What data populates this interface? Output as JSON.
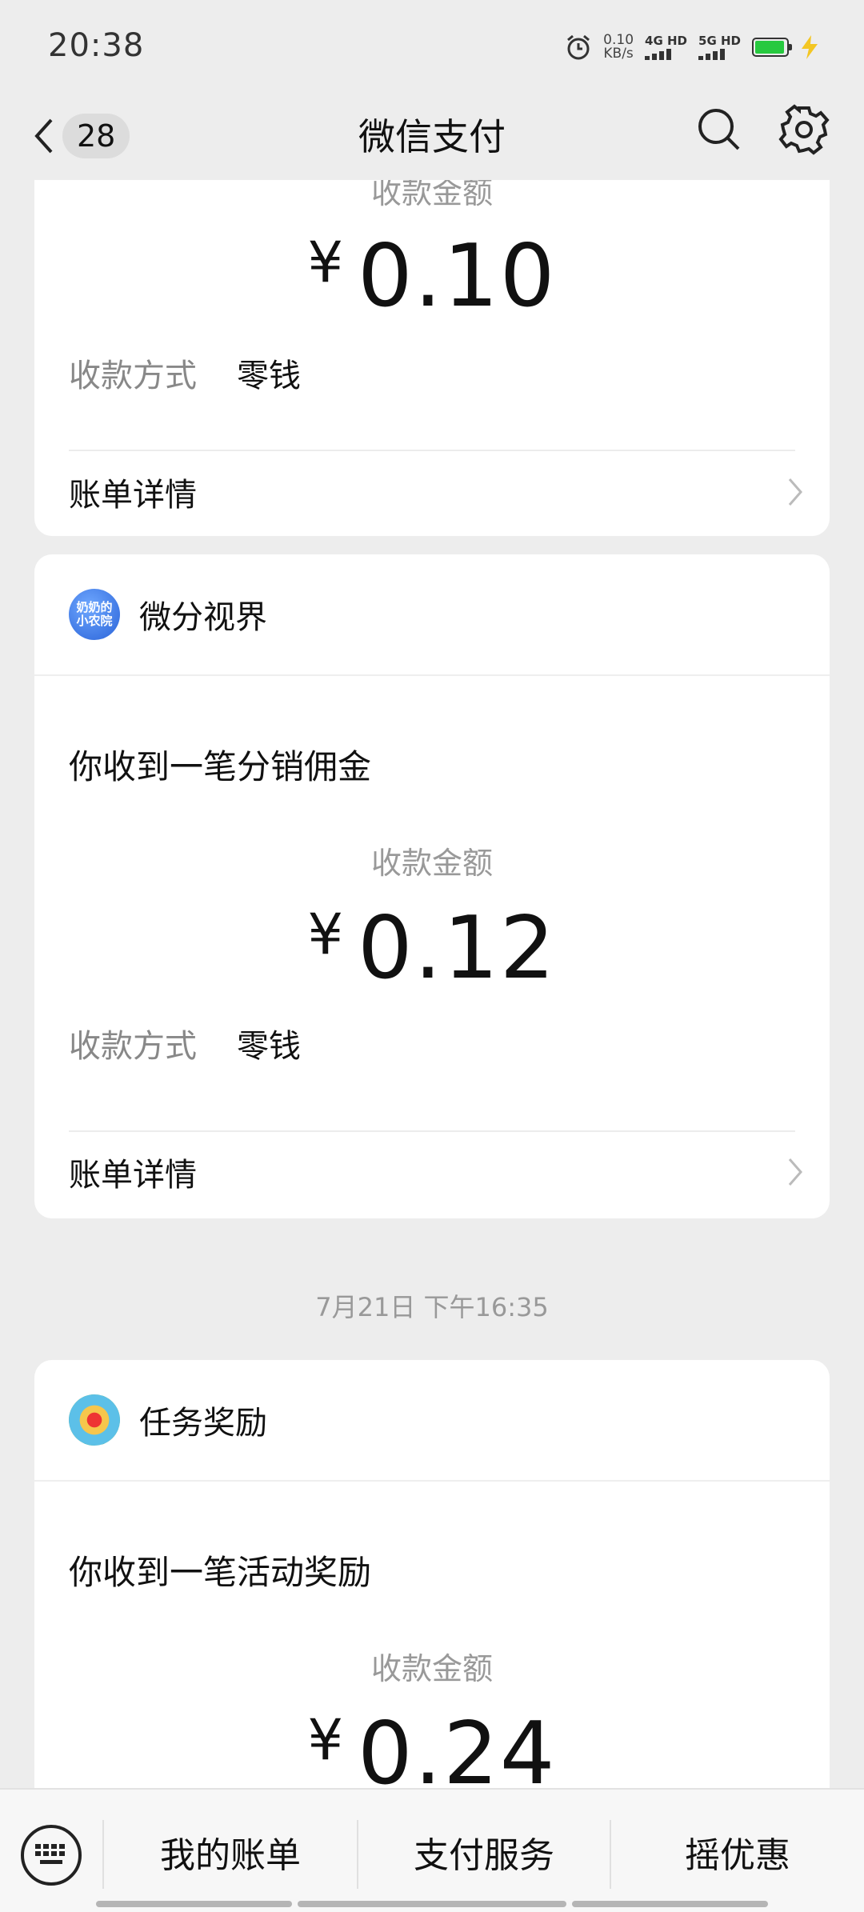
{
  "status_bar": {
    "time": "20:38",
    "net_speed_value": "0.10",
    "net_speed_unit": "KB/s",
    "sim1": "4G HD",
    "sim2": "5G HD"
  },
  "header": {
    "back_count": "28",
    "title": "微信支付"
  },
  "messages": [
    {
      "amount_label": "收款金额",
      "currency": "¥",
      "amount": "0.10",
      "method_label": "收款方式",
      "method_value": "零钱",
      "detail_label": "账单详情"
    },
    {
      "sender": "微分视界",
      "avatar_text": "奶奶的小农院",
      "description": "你收到一笔分销佣金",
      "amount_label": "收款金额",
      "currency": "¥",
      "amount": "0.12",
      "method_label": "收款方式",
      "method_value": "零钱",
      "detail_label": "账单详情"
    },
    {
      "timestamp": "7月21日 下午16:35",
      "sender": "任务奖励",
      "description": "你收到一笔活动奖励",
      "amount_label": "收款金额",
      "currency": "¥",
      "amount": "0.24"
    }
  ],
  "bottom_menu": {
    "items": [
      "我的账单",
      "支付服务",
      "摇优惠"
    ]
  },
  "colors": {
    "background": "#ededed",
    "card": "#ffffff",
    "muted_text": "#999999",
    "battery": "#27c93f"
  }
}
